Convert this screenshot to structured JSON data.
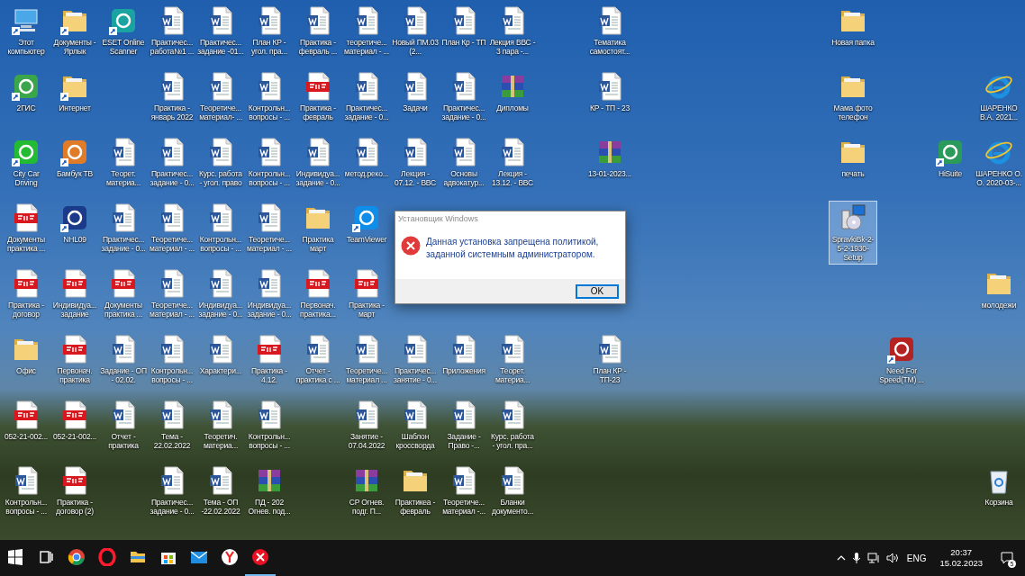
{
  "desktop": {
    "rows": [
      [
        {
          "kind": "pc",
          "label": "Этот компьютер",
          "selected": false,
          "shortcut": true
        },
        {
          "kind": "folder",
          "label": "Документы - Ярлык",
          "selected": false,
          "shortcut": true
        },
        {
          "kind": "app",
          "label": "ESET Online Scanner",
          "color": "#1aa3a0",
          "selected": false,
          "shortcut": true
        },
        {
          "kind": "word",
          "label": "Практичес... работа№1 ...",
          "selected": false,
          "shortcut": false
        },
        {
          "kind": "word",
          "label": "Практичес... задание -01...",
          "selected": false,
          "shortcut": false
        },
        {
          "kind": "word",
          "label": "План КР - угол. пра...",
          "selected": false,
          "shortcut": false
        },
        {
          "kind": "word",
          "label": "Практика - февраль ...",
          "selected": false,
          "shortcut": false
        },
        {
          "kind": "word",
          "label": "теоретиче... материал - ...",
          "selected": false,
          "shortcut": false
        },
        {
          "kind": "word",
          "label": "Новый ПМ.03 (2...",
          "selected": false,
          "shortcut": false
        },
        {
          "kind": "word",
          "label": "План Кр - ТП",
          "selected": false,
          "shortcut": false
        },
        {
          "kind": "word",
          "label": "Лекция ВВС - 3 пара -...",
          "selected": false,
          "shortcut": false
        },
        {
          "kind": "blank"
        },
        {
          "kind": "word",
          "label": "Тематика самостоят...",
          "selected": false,
          "shortcut": false
        },
        {
          "kind": "blank"
        },
        {
          "kind": "blank"
        },
        {
          "kind": "blank"
        },
        {
          "kind": "blank"
        },
        {
          "kind": "folder",
          "label": "Новая папка",
          "selected": false,
          "shortcut": false
        },
        {
          "kind": "blank"
        },
        {
          "kind": "blank"
        },
        {
          "kind": "blank"
        }
      ],
      [
        {
          "kind": "app",
          "label": "2ГИС",
          "color": "#3aa54a",
          "selected": false,
          "shortcut": true
        },
        {
          "kind": "folder",
          "label": "Интернет",
          "selected": false,
          "shortcut": true
        },
        {
          "kind": "blank"
        },
        {
          "kind": "word",
          "label": "Практика - январь 2022",
          "selected": false,
          "shortcut": false
        },
        {
          "kind": "word",
          "label": "Теоретиче... материал- ...",
          "selected": false,
          "shortcut": false
        },
        {
          "kind": "word",
          "label": "Контрольн... вопросы - ...",
          "selected": false,
          "shortcut": false
        },
        {
          "kind": "pdf",
          "label": "Практика - февраль",
          "selected": false,
          "shortcut": false
        },
        {
          "kind": "word",
          "label": "Практичес... задание - 0...",
          "selected": false,
          "shortcut": false
        },
        {
          "kind": "word",
          "label": "Задачи",
          "selected": false,
          "shortcut": false
        },
        {
          "kind": "word",
          "label": "Практичес... задание - 0...",
          "selected": false,
          "shortcut": false
        },
        {
          "kind": "rar",
          "label": "Дипломы",
          "selected": false,
          "shortcut": false
        },
        {
          "kind": "blank"
        },
        {
          "kind": "word",
          "label": "КР - ТП - 23",
          "selected": false,
          "shortcut": false
        },
        {
          "kind": "blank"
        },
        {
          "kind": "blank"
        },
        {
          "kind": "blank"
        },
        {
          "kind": "blank"
        },
        {
          "kind": "folder",
          "label": "Мама фото телефон",
          "selected": false,
          "shortcut": false
        },
        {
          "kind": "blank"
        },
        {
          "kind": "blank"
        },
        {
          "kind": "ie",
          "label": "ШАРЕНКО В.А. 2021...",
          "selected": false,
          "shortcut": false
        }
      ],
      [
        {
          "kind": "app",
          "label": "City Car Driving",
          "color": "#22bb33",
          "selected": false,
          "shortcut": true
        },
        {
          "kind": "app",
          "label": "Бамбук ТВ",
          "color": "#e07b28",
          "selected": false,
          "shortcut": true
        },
        {
          "kind": "word",
          "label": "Теорет. материа...",
          "selected": false,
          "shortcut": false
        },
        {
          "kind": "word",
          "label": "Практичес... задание - 0...",
          "selected": false,
          "shortcut": false
        },
        {
          "kind": "word",
          "label": "Курс. работа - угол. право",
          "selected": false,
          "shortcut": false
        },
        {
          "kind": "word",
          "label": "Контрольн... вопросы - ...",
          "selected": false,
          "shortcut": false
        },
        {
          "kind": "word",
          "label": "Индивидуа... задание - 0...",
          "selected": false,
          "shortcut": false
        },
        {
          "kind": "word",
          "label": "метод.реко...",
          "selected": false,
          "shortcut": false
        },
        {
          "kind": "word",
          "label": "Лекция - 07.12. - ВВС",
          "selected": false,
          "shortcut": false
        },
        {
          "kind": "word",
          "label": "Основы адвокатур...",
          "selected": false,
          "shortcut": false
        },
        {
          "kind": "word",
          "label": "Лекция - 13.12. - ВВС",
          "selected": false,
          "shortcut": false
        },
        {
          "kind": "blank"
        },
        {
          "kind": "rar",
          "label": "13-01-2023...",
          "selected": false,
          "shortcut": false
        },
        {
          "kind": "blank"
        },
        {
          "kind": "blank"
        },
        {
          "kind": "blank"
        },
        {
          "kind": "blank"
        },
        {
          "kind": "folder",
          "label": "печать",
          "selected": false,
          "shortcut": false
        },
        {
          "kind": "blank"
        },
        {
          "kind": "app",
          "label": "HiSuite",
          "color": "#2a9b5a",
          "selected": false,
          "shortcut": true
        },
        {
          "kind": "ie",
          "label": "ШАРЕНКО О. О. 2020-03-...",
          "selected": false,
          "shortcut": false
        }
      ],
      [
        {
          "kind": "pdf",
          "label": "Документы практика ...",
          "selected": false,
          "shortcut": false
        },
        {
          "kind": "app",
          "label": "NHL09",
          "color": "#1b3a8a",
          "selected": false,
          "shortcut": true
        },
        {
          "kind": "word",
          "label": "Практичес... задание - 0...",
          "selected": false,
          "shortcut": false
        },
        {
          "kind": "word",
          "label": "Теоретиче... материал - ...",
          "selected": false,
          "shortcut": false
        },
        {
          "kind": "word",
          "label": "Контрольн... вопросы - ...",
          "selected": false,
          "shortcut": false
        },
        {
          "kind": "word",
          "label": "Теоретиче... материал - ...",
          "selected": false,
          "shortcut": false
        },
        {
          "kind": "folder",
          "label": "Практика март",
          "selected": false,
          "shortcut": false
        },
        {
          "kind": "app",
          "label": "TeamViewer",
          "color": "#0e8ee9",
          "selected": false,
          "shortcut": true
        },
        {
          "kind": "blank"
        },
        {
          "kind": "blank"
        },
        {
          "kind": "blank"
        },
        {
          "kind": "blank"
        },
        {
          "kind": "blank"
        },
        {
          "kind": "blank"
        },
        {
          "kind": "blank"
        },
        {
          "kind": "blank"
        },
        {
          "kind": "blank"
        },
        {
          "kind": "setup",
          "label": "SpravkiBk-2-5-2-1930-Setup",
          "selected": true,
          "shortcut": false
        },
        {
          "kind": "blank"
        },
        {
          "kind": "blank"
        },
        {
          "kind": "blank"
        }
      ],
      [
        {
          "kind": "pdf",
          "label": "Практика - договор",
          "selected": false,
          "shortcut": false
        },
        {
          "kind": "pdf",
          "label": "Индивидуа... задание",
          "selected": false,
          "shortcut": false
        },
        {
          "kind": "pdf",
          "label": "Документы практика ...",
          "selected": false,
          "shortcut": false
        },
        {
          "kind": "word",
          "label": "Теоретиче... материал - ...",
          "selected": false,
          "shortcut": false
        },
        {
          "kind": "word",
          "label": "Индивидуа... задание - 0...",
          "selected": false,
          "shortcut": false
        },
        {
          "kind": "word",
          "label": "Индивидуа... задание - 0...",
          "selected": false,
          "shortcut": false
        },
        {
          "kind": "pdf",
          "label": "Первонач. практика...",
          "selected": false,
          "shortcut": false
        },
        {
          "kind": "pdf",
          "label": "Практика - март",
          "selected": false,
          "shortcut": false
        },
        {
          "kind": "blank"
        },
        {
          "kind": "blank"
        },
        {
          "kind": "blank"
        },
        {
          "kind": "blank"
        },
        {
          "kind": "blank"
        },
        {
          "kind": "blank"
        },
        {
          "kind": "blank"
        },
        {
          "kind": "blank"
        },
        {
          "kind": "blank"
        },
        {
          "kind": "blank"
        },
        {
          "kind": "blank"
        },
        {
          "kind": "blank"
        },
        {
          "kind": "folder",
          "label": "молодежи",
          "selected": false,
          "shortcut": false
        }
      ],
      [
        {
          "kind": "folder",
          "label": "Офис",
          "selected": false,
          "shortcut": false
        },
        {
          "kind": "pdf",
          "label": "Первонач. практика",
          "selected": false,
          "shortcut": false
        },
        {
          "kind": "word",
          "label": "Задание - ОП - 02.02.",
          "selected": false,
          "shortcut": false
        },
        {
          "kind": "word",
          "label": "Контрольн... вопросы - ...",
          "selected": false,
          "shortcut": false
        },
        {
          "kind": "word",
          "label": "Характери...",
          "selected": false,
          "shortcut": false
        },
        {
          "kind": "pdf",
          "label": "Практика - 4.12.",
          "selected": false,
          "shortcut": false
        },
        {
          "kind": "word",
          "label": "Отчет - практика с ...",
          "selected": false,
          "shortcut": false
        },
        {
          "kind": "word",
          "label": "Теоретиче... материал ...",
          "selected": false,
          "shortcut": false
        },
        {
          "kind": "word",
          "label": "Практичес... занятие - 0...",
          "selected": false,
          "shortcut": false
        },
        {
          "kind": "word",
          "label": "Приложения",
          "selected": false,
          "shortcut": false
        },
        {
          "kind": "word",
          "label": "Теорет. материа...",
          "selected": false,
          "shortcut": false
        },
        {
          "kind": "blank"
        },
        {
          "kind": "word",
          "label": "План КР - ТП-23",
          "selected": false,
          "shortcut": false
        },
        {
          "kind": "blank"
        },
        {
          "kind": "blank"
        },
        {
          "kind": "blank"
        },
        {
          "kind": "blank"
        },
        {
          "kind": "blank"
        },
        {
          "kind": "app",
          "label": "Need For Speed(TM) ...",
          "color": "#b52222",
          "selected": false,
          "shortcut": true
        },
        {
          "kind": "blank"
        },
        {
          "kind": "blank"
        }
      ],
      [
        {
          "kind": "pdf",
          "label": "052-21-002...",
          "selected": false,
          "shortcut": false
        },
        {
          "kind": "pdf",
          "label": "052-21-002...",
          "selected": false,
          "shortcut": false
        },
        {
          "kind": "word",
          "label": "Отчет - практика",
          "selected": false,
          "shortcut": false
        },
        {
          "kind": "word",
          "label": "Тема - 22.02.2022",
          "selected": false,
          "shortcut": false
        },
        {
          "kind": "word",
          "label": "Теоретич. материа...",
          "selected": false,
          "shortcut": false
        },
        {
          "kind": "word",
          "label": "Контрольн... вопросы - ...",
          "selected": false,
          "shortcut": false
        },
        {
          "kind": "blank"
        },
        {
          "kind": "word",
          "label": "Занятие - 07.04.2022",
          "selected": false,
          "shortcut": false
        },
        {
          "kind": "word",
          "label": "Шаблон кроссворда",
          "selected": false,
          "shortcut": false
        },
        {
          "kind": "word",
          "label": "Задание - Право -...",
          "selected": false,
          "shortcut": false
        },
        {
          "kind": "word",
          "label": "Курс. работа - угол. пра...",
          "selected": false,
          "shortcut": false
        },
        {
          "kind": "blank"
        },
        {
          "kind": "blank"
        },
        {
          "kind": "blank"
        },
        {
          "kind": "blank"
        },
        {
          "kind": "blank"
        },
        {
          "kind": "blank"
        },
        {
          "kind": "blank"
        },
        {
          "kind": "blank"
        },
        {
          "kind": "blank"
        },
        {
          "kind": "blank"
        }
      ],
      [
        {
          "kind": "word",
          "label": "Контрольн... вопросы - ...",
          "selected": false,
          "shortcut": false
        },
        {
          "kind": "pdf",
          "label": "Практика - договор (2)",
          "selected": false,
          "shortcut": false
        },
        {
          "kind": "blank"
        },
        {
          "kind": "word",
          "label": "Практичес... задание - 0...",
          "selected": false,
          "shortcut": false
        },
        {
          "kind": "word",
          "label": "Тема - ОП -22.02.2022",
          "selected": false,
          "shortcut": false
        },
        {
          "kind": "rar",
          "label": "ПД - 202 Огнев. под...",
          "selected": false,
          "shortcut": false
        },
        {
          "kind": "blank"
        },
        {
          "kind": "rar",
          "label": "СР Огнев. подг. П...",
          "selected": false,
          "shortcut": false
        },
        {
          "kind": "folder",
          "label": "Практикеа - февраль",
          "selected": false,
          "shortcut": false
        },
        {
          "kind": "word",
          "label": "Теоретиче... материал -...",
          "selected": false,
          "shortcut": false
        },
        {
          "kind": "word",
          "label": "Бланки документо...",
          "selected": false,
          "shortcut": false
        },
        {
          "kind": "blank"
        },
        {
          "kind": "blank"
        },
        {
          "kind": "blank"
        },
        {
          "kind": "blank"
        },
        {
          "kind": "blank"
        },
        {
          "kind": "blank"
        },
        {
          "kind": "blank"
        },
        {
          "kind": "blank"
        },
        {
          "kind": "blank"
        },
        {
          "kind": "bin",
          "label": "Корзина",
          "selected": false,
          "shortcut": false
        }
      ]
    ]
  },
  "dialog": {
    "title": "Установщик Windows",
    "message": "Данная установка запрещена политикой, заданной системным администратором.",
    "buttons": [
      "OK"
    ]
  },
  "taskbar": {
    "apps": [
      {
        "kind": "start"
      },
      {
        "kind": "taskview"
      },
      {
        "kind": "chrome"
      },
      {
        "kind": "opera"
      },
      {
        "kind": "explorer"
      },
      {
        "kind": "store"
      },
      {
        "kind": "mail"
      },
      {
        "kind": "yandex"
      },
      {
        "kind": "installer"
      }
    ],
    "language": "ENG",
    "time": "20:37",
    "date": "15.02.2023",
    "notification_count": "5"
  }
}
